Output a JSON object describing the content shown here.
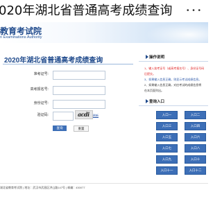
{
  "header": {
    "title": "020年湖北省普通高考成绩查询",
    "more_icon": "ellipsis"
  },
  "hero": {
    "title": "教育考试院",
    "subtitle": "n Examinations Authority"
  },
  "form": {
    "heading": "2020年湖北省普通高考成绩查询",
    "fields": [
      {
        "label": "准考证号:",
        "value": ""
      },
      {
        "label": "高考报名号:",
        "value": ""
      },
      {
        "label": "身份证号:",
        "value": ""
      },
      {
        "label": "验证码:",
        "value": ""
      }
    ],
    "captcha_text": "acdi",
    "refresh_label": "刷新",
    "query_button": "查询",
    "reset_button": "重置"
  },
  "sidebar": {
    "instructions_title": "操作说明",
    "notes": [
      {
        "text": "1、输入准考证号（或高考报名号）、身份证号码",
        "tone": "red"
      },
      {
        "text": "后提交。",
        "tone": "red"
      },
      {
        "text": "3、如果输入信息正确，则显示考试成绩信息。",
        "tone": "blue"
      },
      {
        "text": "2、如果输入信息正确，对应考试的成绩信息将",
        "tone": "normal"
      },
      {
        "text": "在本页面列出。",
        "tone": "normal"
      }
    ],
    "entry_title": "查询入口",
    "entries": [
      "入口一",
      "入口二",
      "入口三",
      "入口四",
      "入口五",
      "入口六",
      "入口七",
      "入口八",
      "入口九",
      "入口十",
      "入口十一",
      "入口十二"
    ]
  },
  "footer": {
    "text": "湖北省教育考试院  |  地址：武汉市武昌区洪山路147号  |  邮编：430077"
  },
  "colors": {
    "accent": "#3d6fb7",
    "heading": "#1f4a8c",
    "warning": "#e02020"
  }
}
